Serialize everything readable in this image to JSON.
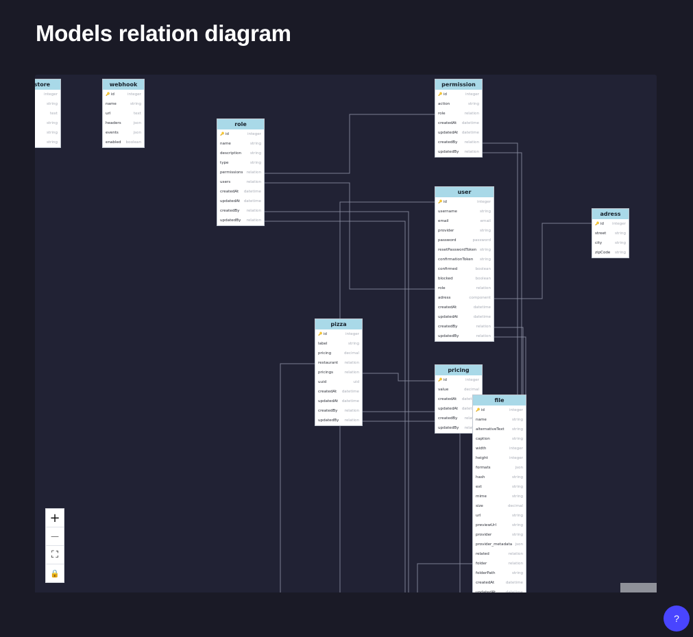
{
  "page": {
    "title": "Models relation diagram"
  },
  "controls": {
    "zoom_in": "+",
    "zoom_out": "—",
    "fit": "⛶",
    "lock": "🔒",
    "help": "?"
  },
  "models": [
    {
      "name": "re-store",
      "fields": [
        [
          "",
          "integer"
        ],
        [
          "",
          "string"
        ],
        [
          "",
          "text"
        ],
        [
          "",
          "string"
        ],
        [
          "",
          "string"
        ],
        [
          "",
          "string"
        ]
      ]
    },
    {
      "name": "webhook",
      "fields": [
        [
          "id",
          "integer",
          true
        ],
        [
          "name",
          "string"
        ],
        [
          "url",
          "text"
        ],
        [
          "headers",
          "json"
        ],
        [
          "events",
          "json"
        ],
        [
          "enabled",
          "boolean"
        ]
      ]
    },
    {
      "name": "role",
      "fields": [
        [
          "id",
          "integer",
          true
        ],
        [
          "name",
          "string"
        ],
        [
          "description",
          "string"
        ],
        [
          "type",
          "string"
        ],
        [
          "permissions",
          "relation"
        ],
        [
          "users",
          "relation"
        ],
        [
          "createdAt",
          "datetime"
        ],
        [
          "updatedAt",
          "datetime"
        ],
        [
          "createdBy",
          "relation"
        ],
        [
          "updatedBy",
          "relation"
        ]
      ]
    },
    {
      "name": "permission",
      "fields": [
        [
          "id",
          "integer",
          true
        ],
        [
          "action",
          "string"
        ],
        [
          "role",
          "relation"
        ],
        [
          "createdAt",
          "datetime"
        ],
        [
          "updatedAt",
          "datetime"
        ],
        [
          "createdBy",
          "relation"
        ],
        [
          "updatedBy",
          "relation"
        ]
      ]
    },
    {
      "name": "user",
      "fields": [
        [
          "id",
          "integer",
          true
        ],
        [
          "username",
          "string"
        ],
        [
          "email",
          "email"
        ],
        [
          "provider",
          "string"
        ],
        [
          "password",
          "password"
        ],
        [
          "resetPasswordToken",
          "string"
        ],
        [
          "confirmationToken",
          "string"
        ],
        [
          "confirmed",
          "boolean"
        ],
        [
          "blocked",
          "boolean"
        ],
        [
          "role",
          "relation"
        ],
        [
          "adress",
          "component"
        ],
        [
          "createdAt",
          "datetime"
        ],
        [
          "updatedAt",
          "datetime"
        ],
        [
          "createdBy",
          "relation"
        ],
        [
          "updatedBy",
          "relation"
        ]
      ]
    },
    {
      "name": "adress",
      "fields": [
        [
          "id",
          "integer",
          true
        ],
        [
          "street",
          "string"
        ],
        [
          "city",
          "string"
        ],
        [
          "zipCode",
          "string"
        ]
      ]
    },
    {
      "name": "pizza",
      "fields": [
        [
          "id",
          "integer",
          true
        ],
        [
          "label",
          "string"
        ],
        [
          "pricing",
          "decimal"
        ],
        [
          "restaurant",
          "relation"
        ],
        [
          "pricings",
          "relation"
        ],
        [
          "uuid",
          "uid"
        ],
        [
          "createdAt",
          "datetime"
        ],
        [
          "updatedAt",
          "datetime"
        ],
        [
          "createdBy",
          "relation"
        ],
        [
          "updatedBy",
          "relation"
        ]
      ]
    },
    {
      "name": "pricing",
      "fields": [
        [
          "id",
          "integer",
          true
        ],
        [
          "value",
          "decimal"
        ],
        [
          "createdAt",
          "datetime"
        ],
        [
          "updatedAt",
          "datetime"
        ],
        [
          "createdBy",
          "relation"
        ],
        [
          "updatedBy",
          "relation"
        ]
      ]
    },
    {
      "name": "file",
      "fields": [
        [
          "id",
          "integer",
          true
        ],
        [
          "name",
          "string"
        ],
        [
          "alternativeText",
          "string"
        ],
        [
          "caption",
          "string"
        ],
        [
          "width",
          "integer"
        ],
        [
          "height",
          "integer"
        ],
        [
          "formats",
          "json"
        ],
        [
          "hash",
          "string"
        ],
        [
          "ext",
          "string"
        ],
        [
          "mime",
          "string"
        ],
        [
          "size",
          "decimal"
        ],
        [
          "url",
          "string"
        ],
        [
          "previewUrl",
          "string"
        ],
        [
          "provider",
          "string"
        ],
        [
          "provider_metadata",
          "json"
        ],
        [
          "related",
          "relation"
        ],
        [
          "folder",
          "relation"
        ],
        [
          "folderPath",
          "string"
        ],
        [
          "createdAt",
          "datetime"
        ],
        [
          "updatedAt",
          "datetime"
        ]
      ]
    }
  ]
}
